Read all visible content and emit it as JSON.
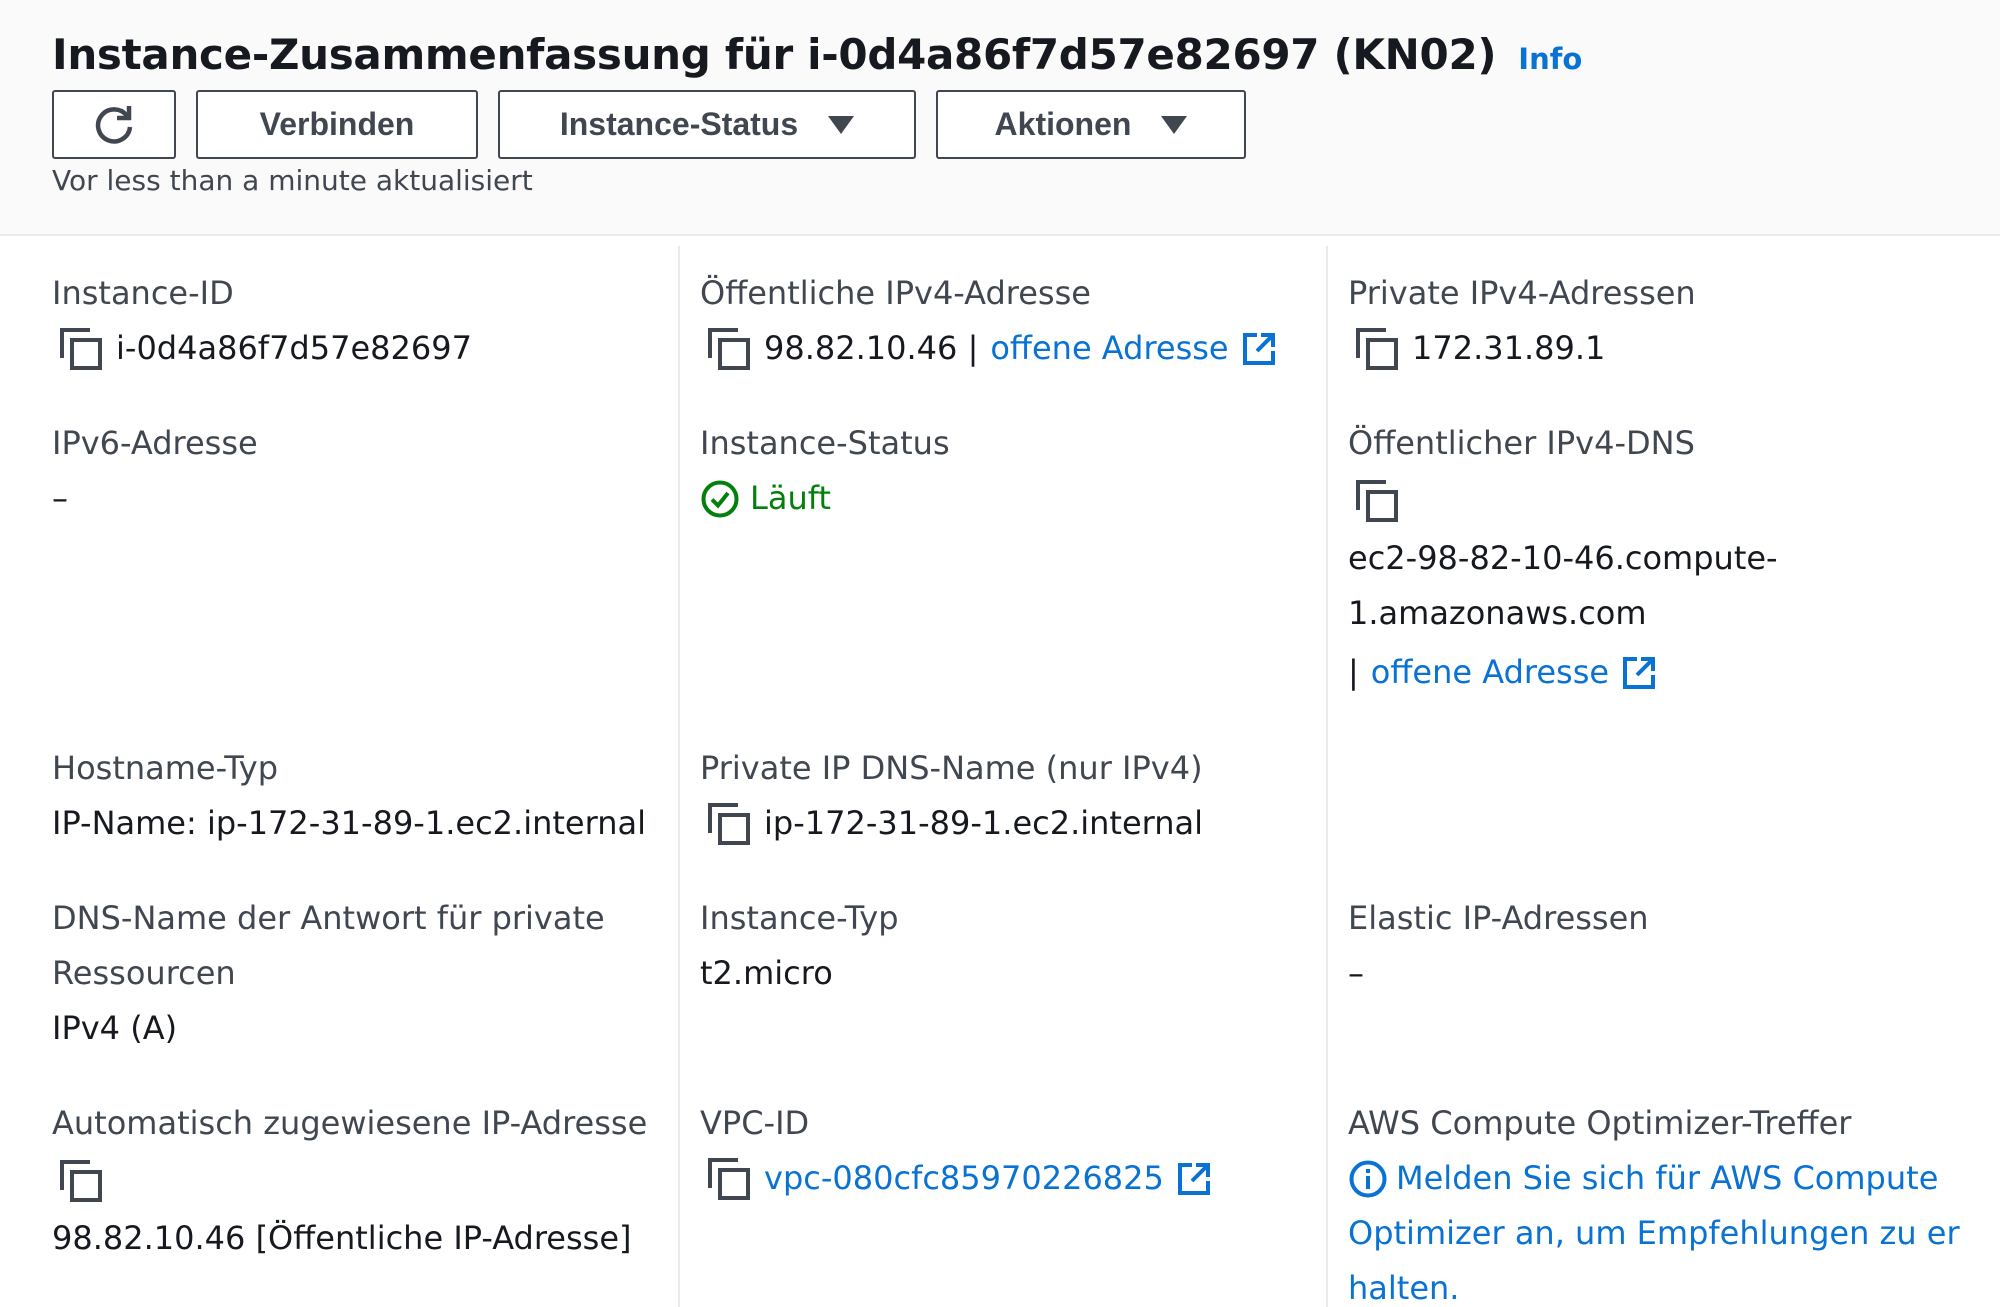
{
  "header": {
    "title": "Instance-Zusammenfassung für i-0d4a86f7d57e82697 (KN02)",
    "info": "Info",
    "buttons": {
      "connect": "Verbinden",
      "status": "Instance-Status",
      "actions": "Aktionen"
    },
    "updated": "Vor less than a minute aktualisiert"
  },
  "fields": {
    "instance_id": {
      "label": "Instance-ID",
      "value": "i-0d4a86f7d57e82697"
    },
    "public_ipv4": {
      "label": "Öffentliche IPv4-Adresse",
      "value": "98.82.10.46 |",
      "link": "offene Adresse"
    },
    "private_ipv4": {
      "label": "Private IPv4-Adressen",
      "value": "172.31.89.1"
    },
    "ipv6": {
      "label": "IPv6-Adresse",
      "value": "–"
    },
    "instance_status": {
      "label": "Instance-Status",
      "value": "Läuft"
    },
    "public_dns": {
      "label": "Öffentlicher IPv4-DNS",
      "line1": "ec2-98-82-10-46.compute-",
      "line2": "1.amazonaws.com",
      "sep": "|",
      "link": "offene Adresse"
    },
    "hostname_type": {
      "label": "Hostname-Typ",
      "value": "IP-Name: ip-172-31-89-1.ec2.internal"
    },
    "private_dns": {
      "label": "Private IP DNS-Name (nur IPv4)",
      "value": "ip-172-31-89-1.ec2.internal"
    },
    "answer_dns": {
      "label_line1": "DNS-Name der Antwort für private",
      "label_line2": "Ressourcen",
      "value": "IPv4 (A)"
    },
    "instance_type": {
      "label": "Instance-Typ",
      "value": "t2.micro"
    },
    "elastic_ip": {
      "label": "Elastic IP-Adressen",
      "value": "–"
    },
    "auto_ip": {
      "label": "Automatisch zugewiesene IP-Adresse",
      "value": "98.82.10.46 [Öffentliche IP-Adresse]"
    },
    "vpc_id": {
      "label": "VPC-ID",
      "value": "vpc-080cfc85970226825"
    },
    "optimizer": {
      "label": "AWS Compute Optimizer-Treffer",
      "line1": "Melden Sie sich für AWS Compute",
      "line2": "Optimizer an, um Empfehlungen zu er",
      "line3": "halten."
    }
  },
  "colors": {
    "link": "#0972d3",
    "success": "#037f0c",
    "text": "#16191f",
    "label": "#414750"
  }
}
